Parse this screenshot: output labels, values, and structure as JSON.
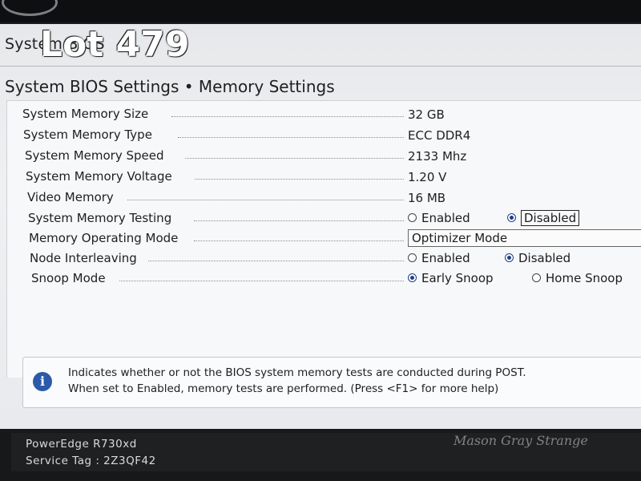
{
  "app": {
    "title": "System BIOS"
  },
  "overlay": {
    "lot": "Lot 479"
  },
  "page": {
    "heading": "System BIOS Settings • Memory Settings"
  },
  "settings": [
    {
      "label": "System Memory Size",
      "value": "32 GB"
    },
    {
      "label": "System Memory Type",
      "value": "ECC DDR4"
    },
    {
      "label": "System Memory Speed",
      "value": "2133 Mhz"
    },
    {
      "label": "System Memory Voltage",
      "value": "1.20 V"
    },
    {
      "label": "Video Memory",
      "value": "16 MB"
    },
    {
      "label": "System Memory Testing",
      "options": [
        "Enabled",
        "Disabled"
      ],
      "selected": "Disabled"
    },
    {
      "label": "Memory Operating Mode",
      "value": "Optimizer Mode"
    },
    {
      "label": "Node Interleaving",
      "options": [
        "Enabled",
        "Disabled"
      ],
      "selected": "Disabled"
    },
    {
      "label": "Snoop Mode",
      "options": [
        "Early Snoop",
        "Home Snoop"
      ],
      "selected": "Early Snoop"
    }
  ],
  "help": {
    "icon": "info-icon",
    "line1": "Indicates whether or not the BIOS system memory tests are conducted during POST.",
    "line2": "When set to Enabled, memory tests are performed. (Press <F1> for more help)"
  },
  "footer": {
    "model": "PowerEdge R730xd",
    "service_tag": "Service Tag : 2Z3QF42"
  },
  "watermark": "Mason Gray Strange",
  "colors": {
    "accent": "#1f3f86",
    "info": "#2c5aa8"
  }
}
